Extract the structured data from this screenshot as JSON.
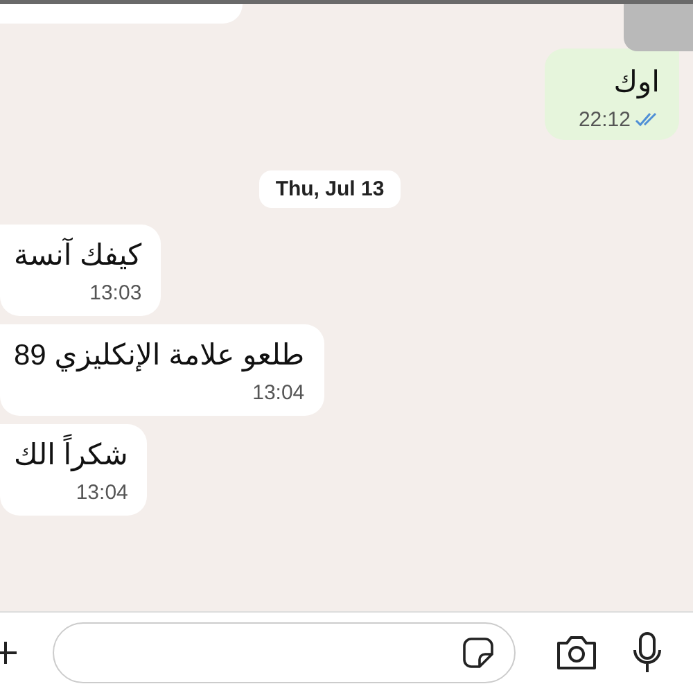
{
  "messages": [
    {
      "kind": "outgoing",
      "text": "اوك",
      "time": "22:12",
      "read": true
    },
    {
      "kind": "date",
      "label": "Thu, Jul 13"
    },
    {
      "kind": "incoming",
      "text": "كيفك آنسة",
      "time": "13:03"
    },
    {
      "kind": "incoming",
      "text": "طلعو علامة الإنكليزي 89",
      "time": "13:04"
    },
    {
      "kind": "incoming",
      "text": "شكراً الك",
      "time": "13:04"
    }
  ]
}
